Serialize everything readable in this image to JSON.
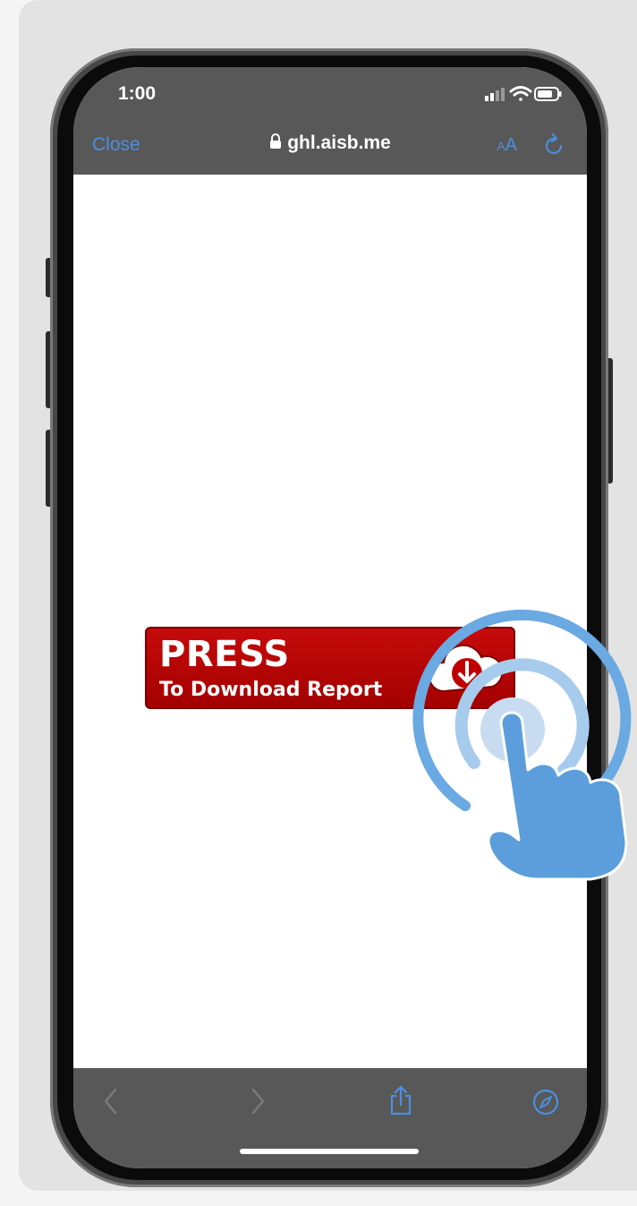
{
  "status_bar": {
    "time": "1:00",
    "signal_icon": "cellular-signal-icon",
    "wifi_icon": "wifi-icon",
    "battery_icon": "battery-icon"
  },
  "browser_header": {
    "close_label": "Close",
    "url": "ghl.aisb.me",
    "lock_icon": "lock-icon",
    "text_size_small": "A",
    "text_size_big": "A",
    "reload_icon": "reload-icon",
    "accent_color": "#4a8fe0"
  },
  "page": {
    "banner_title": "PRESS",
    "banner_subtitle": "To Download Report",
    "banner_icon": "cloud-download-icon",
    "banner_color": "#c00000",
    "overlay_icon": "tap-hand-icon"
  },
  "toolbar": {
    "back_icon": "chevron-left-icon",
    "forward_icon": "chevron-right-icon",
    "share_icon": "share-icon",
    "compass_icon": "compass-icon"
  }
}
